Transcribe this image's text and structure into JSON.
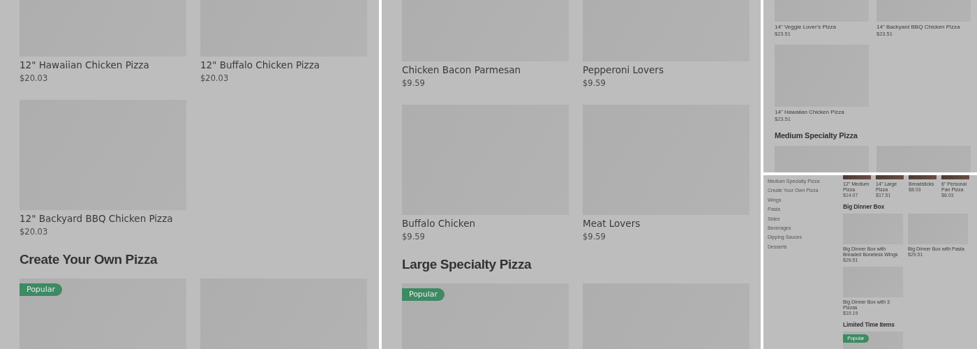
{
  "panels": [
    {
      "sections": [
        {
          "items": [
            {
              "kind": "blank",
              "name": "12\" Hawaiian Chicken Pizza",
              "price": "$20.03"
            },
            {
              "kind": "blank",
              "name": "12\" Buffalo Chicken Pizza",
              "price": "$20.03"
            },
            {
              "kind": "blank",
              "name": "12\" Backyard BBQ Chicken Pizza",
              "price": "$20.03"
            }
          ]
        },
        {
          "title": "Create Your Own Pizza",
          "items": [
            {
              "kind": "blank",
              "badge": "Popular"
            },
            {
              "kind": "blank"
            }
          ]
        }
      ]
    },
    {
      "sections": [
        {
          "items": [
            {
              "kind": "blank",
              "name": "Chicken Bacon Parmesan",
              "price": "$9.59"
            },
            {
              "kind": "blank",
              "name": "Pepperoni Lovers",
              "price": "$9.59"
            },
            {
              "kind": "blank",
              "name": "Buffalo Chicken",
              "price": "$9.59"
            },
            {
              "kind": "blank",
              "name": "Meat Lovers",
              "price": "$9.59"
            }
          ]
        },
        {
          "title": "Large Specialty Pizza",
          "items": [
            {
              "kind": "blank",
              "badge": "Popular"
            },
            {
              "kind": "blank"
            }
          ]
        }
      ]
    },
    {
      "sections": [
        {
          "items": [
            {
              "kind": "blank",
              "name": "14\" Veggie Lover's Pizza",
              "price": "$23.51"
            },
            {
              "kind": "blank",
              "name": "14\" Backyard BBQ Chicken Pizza",
              "price": "$23.51"
            },
            {
              "kind": "blank",
              "name": "14\" Hawaiian Chicken Pizza",
              "price": "$23.51"
            }
          ]
        },
        {
          "title": "Medium Specialty Pizza",
          "items": [
            {
              "kind": "blank"
            },
            {
              "kind": "blank"
            }
          ]
        }
      ]
    },
    {
      "sidebar": [
        "Medium Specialty Pizza",
        "Create Your Own Pizza",
        "Wings",
        "Pasta",
        "Sides",
        "Beverages",
        "Dipping Sauces",
        "Desserts"
      ],
      "sections": [
        {
          "items": [
            {
              "name": "12\" Medium Pizza",
              "price": "$14.07"
            },
            {
              "name": "14\" Large Pizza",
              "price": "$17.51"
            },
            {
              "name": "Breadsticks",
              "price": "$8.03"
            },
            {
              "name": "6\" Personal Pan Pizza",
              "price": "$8.03"
            }
          ]
        },
        {
          "title": "Big Dinner Box",
          "items": [
            {
              "kind": "blank",
              "name": "Big Dinner Box with Breaded Boneless Wings",
              "price": "$29.51"
            },
            {
              "kind": "blank",
              "name": "Big Dinner Box with Pasta",
              "price": "$29.51"
            },
            {
              "kind": "blank",
              "name": "Big Dinner Box with 3 Pizzas",
              "price": "$19.19"
            }
          ]
        },
        {
          "title": "Limited Time Items",
          "items": [
            {
              "kind": "blank",
              "badge": "Popular"
            }
          ]
        }
      ]
    }
  ]
}
